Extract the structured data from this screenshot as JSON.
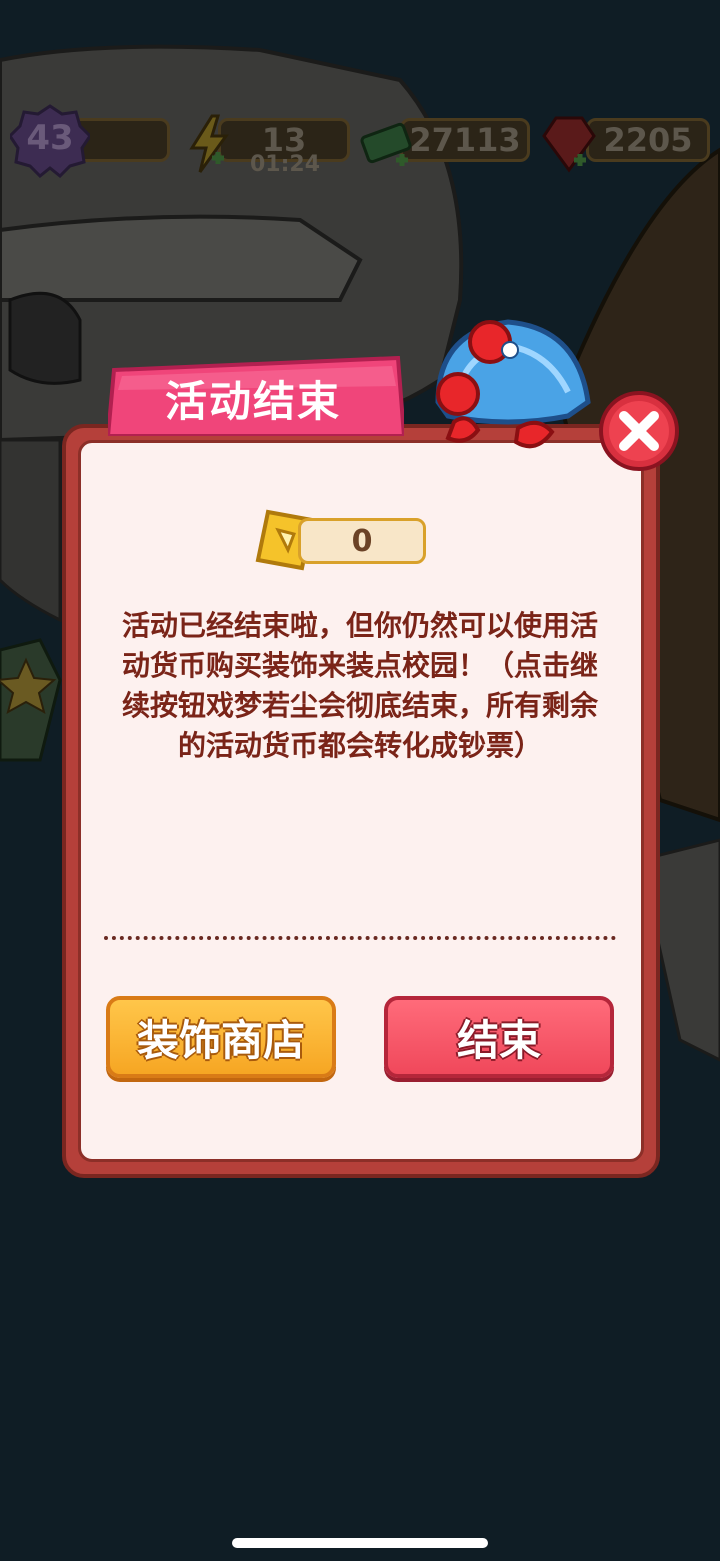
{
  "hud": {
    "level": "43",
    "energy": "13",
    "energy_timer": "01:24",
    "cash": "27113",
    "gems": "2205"
  },
  "dialog": {
    "title": "活动结束",
    "currency_count": "0",
    "message": "活动已经结束啦，但你仍然可以使用活动货币购买装饰来装点校园！（点击继续按钮戏梦若尘会彻底结束，所有剩余的活动货币都会转化成钞票）",
    "shop_button": "装饰商店",
    "end_button": "结束"
  },
  "colors": {
    "dialog_border": "#b5403a",
    "dialog_bg": "#fdf1ef",
    "tab_pink": "#f0457a",
    "shop_orange": "#f6a623",
    "end_red": "#f0485b",
    "text_dark_red": "#7a2418"
  },
  "icons": {
    "level": "purple-gear-badge",
    "energy": "lightning-icon",
    "cash": "cash-stack-icon",
    "gems": "red-gem-icon",
    "close": "close-x-icon",
    "ticket": "event-ticket-icon"
  }
}
